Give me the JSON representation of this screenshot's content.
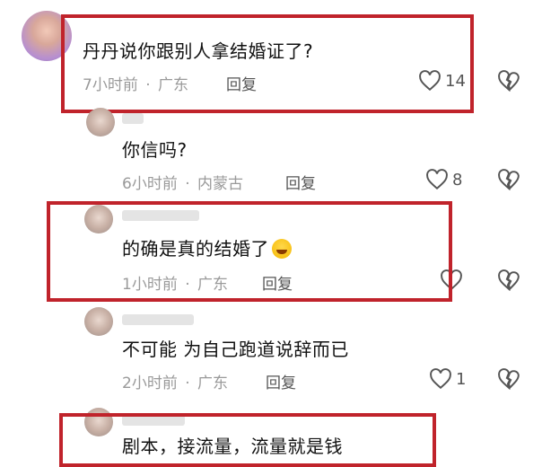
{
  "comments": [
    {
      "text": "丹丹说你跟别人拿结婚证了?",
      "time": "7小时前",
      "location": "广东",
      "reply_label": "回复",
      "likes": "14"
    },
    {
      "text": "你信吗?",
      "time": "6小时前",
      "location": "内蒙古",
      "reply_label": "回复",
      "likes": "8"
    },
    {
      "text": "的确是真的结婚了",
      "time": "1小时前",
      "location": "广东",
      "reply_label": "回复",
      "likes": ""
    },
    {
      "text": "不可能 为自己跑道说辞而已",
      "time": "2小时前",
      "location": "广东",
      "reply_label": "回复",
      "likes": "1"
    },
    {
      "text": "剧本，接流量，流量就是钱",
      "time": "",
      "location": "",
      "reply_label": "",
      "likes": ""
    }
  ],
  "separator": "·",
  "colors": {
    "highlight_box": "#c0232b",
    "meta": "#9a9a9a"
  },
  "icons": {
    "like": "heart-outline-icon",
    "dislike": "broken-heart-icon",
    "emoji": "laughing-crying-emoji"
  }
}
